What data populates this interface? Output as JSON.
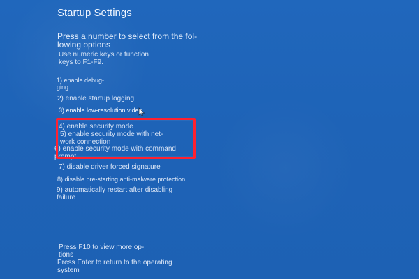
{
  "screen": {
    "title": "Startup Settings",
    "instruction": "Press a number to select from the fol-\nlowing options",
    "hint": "Use numeric keys or function\nkeys to F1-F9.",
    "options": [
      "1) enable debug-\nging",
      "2) enable startup logging",
      "3) enable low-resolution video",
      "4) enable security mode",
      "5) enable security mode with net-\nwork connection",
      "6) enable security mode with command\nprompt",
      "7) disable driver forced signature",
      "8) disable pre-starting anti-malware protection",
      "9) automatically restart after disabling\nfailure"
    ],
    "footer": {
      "more": "Press F10 to view more op-\ntions",
      "return": "Press Enter to return to the operating\nsystem"
    }
  },
  "colors": {
    "background": "#1f64b9",
    "text": "#dbe7f8",
    "selection_border": "#ff2130"
  },
  "icons": {
    "cursor": "mouse-cursor-icon"
  }
}
